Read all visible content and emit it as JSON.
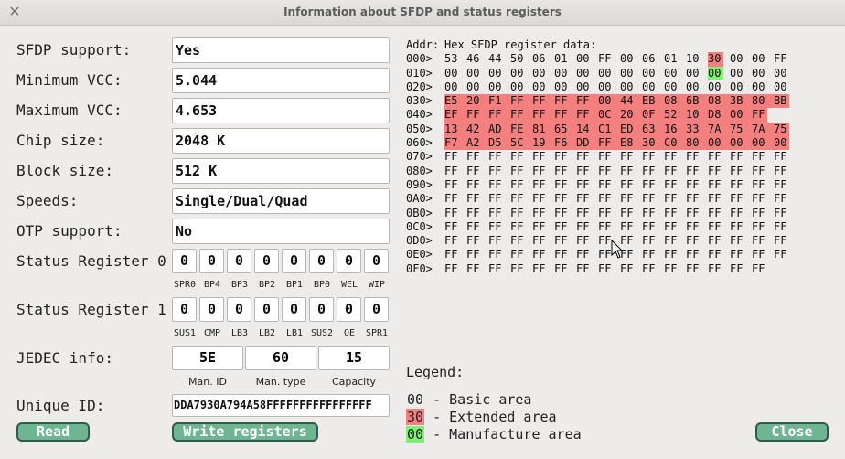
{
  "window": {
    "title": "Information about SFDP and status registers"
  },
  "fields": [
    {
      "label": "SFDP support:",
      "value": "Yes"
    },
    {
      "label": "Minimum VCC:",
      "value": "5.044"
    },
    {
      "label": "Maximum VCC:",
      "value": "4.653"
    },
    {
      "label": "Chip size:",
      "value": "2048 K"
    },
    {
      "label": "Block size:",
      "value": "512 K"
    },
    {
      "label": "Speeds:",
      "value": "Single/Dual/Quad"
    },
    {
      "label": "OTP support:",
      "value": "No"
    }
  ],
  "status0": {
    "label": "Status Register 0",
    "bits": [
      "0",
      "0",
      "0",
      "0",
      "0",
      "0",
      "0",
      "0"
    ],
    "bit_names": [
      "SPR0",
      "BP4",
      "BP3",
      "BP2",
      "BP1",
      "BP0",
      "WEL",
      "WIP"
    ]
  },
  "status1": {
    "label": "Status Register 1",
    "bits": [
      "0",
      "0",
      "0",
      "0",
      "0",
      "0",
      "0",
      "0"
    ],
    "bit_names": [
      "SUS1",
      "CMP",
      "LB3",
      "LB2",
      "LB1",
      "SUS2",
      "QE",
      "SPR1"
    ]
  },
  "jedec": {
    "label": "JEDEC info:",
    "values": [
      "5E",
      "60",
      "15"
    ],
    "captions": [
      "Man. ID",
      "Man. type",
      "Capacity"
    ]
  },
  "unique_id": {
    "label": "Unique ID:",
    "value": "DDA7930A794A58FFFFFFFFFFFFFFFF"
  },
  "buttons": {
    "read": "Read",
    "write": "Write registers",
    "close": "Close"
  },
  "hex": {
    "header_addr": "Addr:",
    "header_title": "Hex SFDP register data:",
    "rows": [
      {
        "addr": "000>",
        "bytes": [
          "53",
          "46",
          "44",
          "50",
          "06",
          "01",
          "00",
          "FF",
          "00",
          "06",
          "01",
          "10",
          "30",
          "00",
          "00",
          "FF"
        ],
        "kinds": [
          "",
          "",
          "",
          "",
          "",
          "",
          "",
          "",
          "",
          "",
          "",
          "",
          "ext",
          "",
          "",
          ""
        ]
      },
      {
        "addr": "010>",
        "bytes": [
          "00",
          "00",
          "00",
          "00",
          "00",
          "00",
          "00",
          "00",
          "00",
          "00",
          "00",
          "00",
          "00",
          "00",
          "00",
          "00"
        ],
        "kinds": [
          "",
          "",
          "",
          "",
          "",
          "",
          "",
          "",
          "",
          "",
          "",
          "",
          "mfg",
          "",
          "",
          ""
        ]
      },
      {
        "addr": "020>",
        "bytes": [
          "00",
          "00",
          "00",
          "00",
          "00",
          "00",
          "00",
          "00",
          "00",
          "00",
          "00",
          "00",
          "00",
          "00",
          "00",
          "00"
        ],
        "kinds": []
      },
      {
        "addr": "030>",
        "bytes": [
          "E5",
          "20",
          "F1",
          "FF",
          "FF",
          "FF",
          "FF",
          "00",
          "44",
          "EB",
          "08",
          "6B",
          "08",
          "3B",
          "80",
          "BB"
        ],
        "kinds": [
          "ext",
          "ext",
          "ext",
          "ext",
          "ext",
          "ext",
          "ext",
          "ext",
          "ext",
          "ext",
          "ext",
          "ext",
          "ext",
          "ext",
          "ext",
          "ext"
        ]
      },
      {
        "addr": "040>",
        "bytes": [
          "EF",
          "FF",
          "FF",
          "FF",
          "FF",
          "FF",
          "FF",
          "0C",
          "20",
          "0F",
          "52",
          "10",
          "D8",
          "00",
          "FF"
        ],
        "kinds": [
          "ext",
          "ext",
          "ext",
          "ext",
          "ext",
          "ext",
          "ext",
          "ext",
          "ext",
          "ext",
          "ext",
          "ext",
          "ext",
          "ext",
          "ext"
        ]
      },
      {
        "addr": "050>",
        "bytes": [
          "13",
          "42",
          "AD",
          "FE",
          "81",
          "65",
          "14",
          "C1",
          "ED",
          "63",
          "16",
          "33",
          "7A",
          "75",
          "7A",
          "75"
        ],
        "kinds": [
          "ext",
          "ext",
          "ext",
          "ext",
          "ext",
          "ext",
          "ext",
          "ext",
          "ext",
          "ext",
          "ext",
          "ext",
          "ext",
          "ext",
          "ext",
          "ext"
        ]
      },
      {
        "addr": "060>",
        "bytes": [
          "F7",
          "A2",
          "D5",
          "5C",
          "19",
          "F6",
          "DD",
          "FF",
          "E8",
          "30",
          "C0",
          "80",
          "00",
          "00",
          "00",
          "00"
        ],
        "kinds": [
          "ext",
          "ext",
          "ext",
          "ext",
          "ext",
          "ext",
          "ext",
          "ext",
          "ext",
          "ext",
          "ext",
          "ext",
          "ext",
          "ext",
          "ext",
          "ext"
        ]
      },
      {
        "addr": "070>",
        "bytes": [
          "FF",
          "FF",
          "FF",
          "FF",
          "FF",
          "FF",
          "FF",
          "FF",
          "FF",
          "FF",
          "FF",
          "FF",
          "FF",
          "FF",
          "FF",
          "FF"
        ],
        "kinds": []
      },
      {
        "addr": "080>",
        "bytes": [
          "FF",
          "FF",
          "FF",
          "FF",
          "FF",
          "FF",
          "FF",
          "FF",
          "FF",
          "FF",
          "FF",
          "FF",
          "FF",
          "FF",
          "FF",
          "FF"
        ],
        "kinds": []
      },
      {
        "addr": "090>",
        "bytes": [
          "FF",
          "FF",
          "FF",
          "FF",
          "FF",
          "FF",
          "FF",
          "FF",
          "FF",
          "FF",
          "FF",
          "FF",
          "FF",
          "FF",
          "FF",
          "FF"
        ],
        "kinds": []
      },
      {
        "addr": "0A0>",
        "bytes": [
          "FF",
          "FF",
          "FF",
          "FF",
          "FF",
          "FF",
          "FF",
          "FF",
          "FF",
          "FF",
          "FF",
          "FF",
          "FF",
          "FF",
          "FF",
          "FF"
        ],
        "kinds": []
      },
      {
        "addr": "0B0>",
        "bytes": [
          "FF",
          "FF",
          "FF",
          "FF",
          "FF",
          "FF",
          "FF",
          "FF",
          "FF",
          "FF",
          "FF",
          "FF",
          "FF",
          "FF",
          "FF",
          "FF"
        ],
        "kinds": []
      },
      {
        "addr": "0C0>",
        "bytes": [
          "FF",
          "FF",
          "FF",
          "FF",
          "FF",
          "FF",
          "FF",
          "FF",
          "FF",
          "FF",
          "FF",
          "FF",
          "FF",
          "FF",
          "FF",
          "FF"
        ],
        "kinds": []
      },
      {
        "addr": "0D0>",
        "bytes": [
          "FF",
          "FF",
          "FF",
          "FF",
          "FF",
          "FF",
          "FF",
          "FF",
          "FF",
          "FF",
          "FF",
          "FF",
          "FF",
          "FF",
          "FF",
          "FF"
        ],
        "kinds": []
      },
      {
        "addr": "0E0>",
        "bytes": [
          "FF",
          "FF",
          "FF",
          "FF",
          "FF",
          "FF",
          "FF",
          "FF",
          "FF",
          "FF",
          "FF",
          "FF",
          "FF",
          "FF",
          "FF",
          "FF"
        ],
        "kinds": []
      },
      {
        "addr": "0F0>",
        "bytes": [
          "FF",
          "FF",
          "FF",
          "FF",
          "FF",
          "FF",
          "FF",
          "FF",
          "FF",
          "FF",
          "FF",
          "FF",
          "FF",
          "FF",
          "FF"
        ],
        "kinds": []
      }
    ]
  },
  "legend": {
    "title": "Legend:",
    "items": [
      {
        "code": "00",
        "text": " - Basic area",
        "color": ""
      },
      {
        "code": "30",
        "text": " - Extended area",
        "color": "#f47f7f"
      },
      {
        "code": "00",
        "text": " - Manufacture area",
        "color": "#80f074"
      }
    ]
  }
}
